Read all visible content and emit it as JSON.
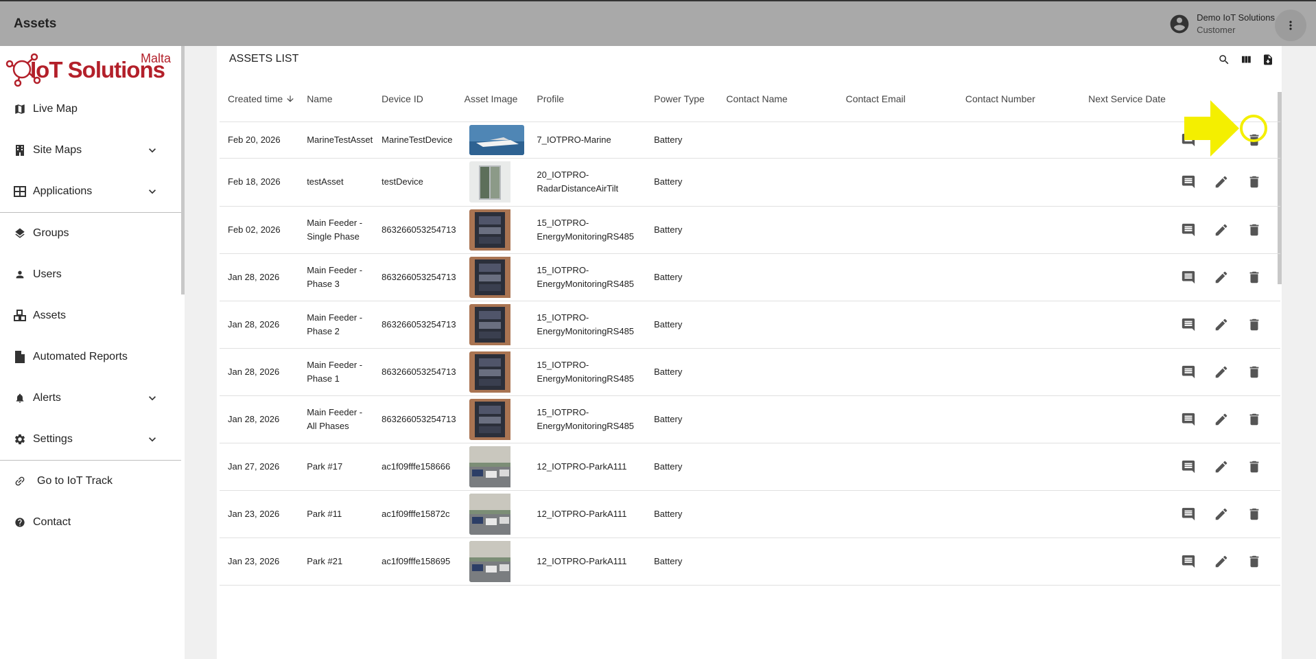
{
  "app": {
    "title": "Assets"
  },
  "user": {
    "name": "Demo IoT Solutions",
    "role": "Customer"
  },
  "logo": {
    "brand": "IoT Solutions",
    "region": "Malta"
  },
  "sidebar": {
    "items": [
      {
        "label": "Live Map",
        "icon": "map-icon"
      },
      {
        "label": "Site Maps",
        "icon": "building-icon"
      },
      {
        "label": "Applications",
        "icon": "grid-icon"
      },
      {
        "label": "Groups",
        "icon": "layers-icon"
      },
      {
        "label": "Users",
        "icon": "person-icon"
      },
      {
        "label": "Assets",
        "icon": "cubes-icon"
      },
      {
        "label": "Automated Reports",
        "icon": "file-icon"
      },
      {
        "label": "Alerts",
        "icon": "bell-icon"
      },
      {
        "label": "Settings",
        "icon": "gear-icon"
      },
      {
        "label": "Go to IoT Track",
        "icon": "link-icon"
      },
      {
        "label": "Contact",
        "icon": "help-icon"
      }
    ]
  },
  "main": {
    "heading": "ASSETS LIST",
    "columns": [
      "Created time",
      "Name",
      "Device ID",
      "Asset Image",
      "Profile",
      "Power Type",
      "Contact Name",
      "Contact Email",
      "Contact Number",
      "Next Service Date"
    ],
    "rows": [
      {
        "created": "Feb 20, 2026",
        "name": "MarineTestAsset",
        "device": "MarineTestDevice",
        "image": "boat",
        "profile": "7_IOTPRO-Marine",
        "power": "Battery"
      },
      {
        "created": "Feb 18, 2026",
        "name": "testAsset",
        "device": "testDevice",
        "image": "fridge",
        "profile": "20_IOTPRO-RadarDistanceAirTilt",
        "power": "Battery"
      },
      {
        "created": "Feb 02, 2026",
        "name": "Main Feeder - Single Phase",
        "device": "863266053254713",
        "image": "panel",
        "profile": "15_IOTPRO-EnergyMonitoringRS485",
        "power": "Battery"
      },
      {
        "created": "Jan 28, 2026",
        "name": "Main Feeder - Phase 3",
        "device": "863266053254713",
        "image": "panel",
        "profile": "15_IOTPRO-EnergyMonitoringRS485",
        "power": "Battery"
      },
      {
        "created": "Jan 28, 2026",
        "name": "Main Feeder - Phase 2",
        "device": "863266053254713",
        "image": "panel",
        "profile": "15_IOTPRO-EnergyMonitoringRS485",
        "power": "Battery"
      },
      {
        "created": "Jan 28, 2026",
        "name": "Main Feeder - Phase 1",
        "device": "863266053254713",
        "image": "panel",
        "profile": "15_IOTPRO-EnergyMonitoringRS485",
        "power": "Battery"
      },
      {
        "created": "Jan 28, 2026",
        "name": "Main Feeder - All Phases",
        "device": "863266053254713",
        "image": "panel",
        "profile": "15_IOTPRO-EnergyMonitoringRS485",
        "power": "Battery"
      },
      {
        "created": "Jan 27, 2026",
        "name": "Park #17",
        "device": "ac1f09fffe158666",
        "image": "parking",
        "profile": "12_IOTPRO-ParkA111",
        "power": "Battery"
      },
      {
        "created": "Jan 23, 2026",
        "name": "Park #11",
        "device": "ac1f09fffe15872c",
        "image": "parking",
        "profile": "12_IOTPRO-ParkA111",
        "power": "Battery"
      },
      {
        "created": "Jan 23, 2026",
        "name": "Park #21",
        "device": "ac1f09fffe158695",
        "image": "parking",
        "profile": "12_IOTPRO-ParkA111",
        "power": "Battery"
      }
    ]
  },
  "colors": {
    "topbar": "#a9a9a9",
    "logo_red": "#b3202a",
    "highlight": "#f4ef00"
  }
}
